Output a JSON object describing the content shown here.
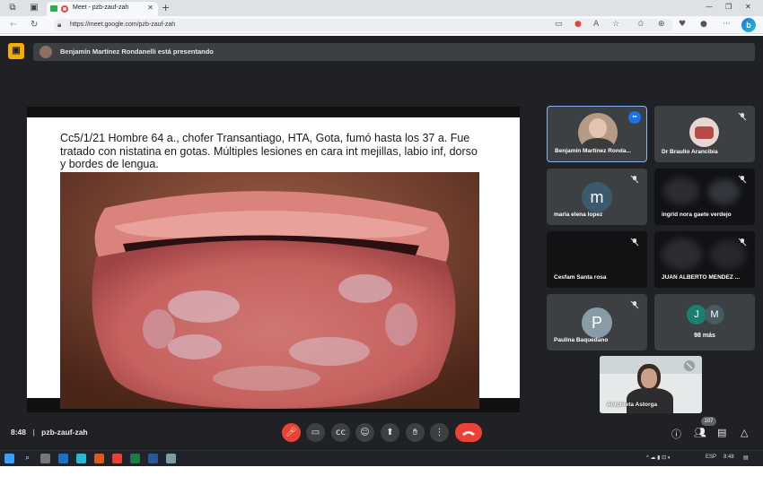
{
  "browser": {
    "tab_title": "Meet - pzb-zauf-zah",
    "url": "https://meet.google.com/pzb-zauf-zah"
  },
  "presenting": {
    "text": "Benjamín Martínez Rondanelli está presentando"
  },
  "slide": {
    "text": "Cc5/1/21 Hombre 64 a., chofer Transantiago, HTA, Gota, fumó hasta los 37 a. Fue tratado con nistatina en gotas. Múltiples lesiones en cara int mejillas, labio inf, dorso y bordes de lengua."
  },
  "participants": [
    {
      "name": "Benjamín Martínez Ronda...",
      "kind": "photo",
      "active": true
    },
    {
      "name": "Dr Braulio Arancibia",
      "kind": "photo"
    },
    {
      "name": "maria elena lopez",
      "kind": "letter",
      "letter": "m",
      "color": "#3c5a6e"
    },
    {
      "name": "ingrid nora gaete verdejo",
      "kind": "blur"
    },
    {
      "name": "Cesfam Santa rosa",
      "kind": "dark"
    },
    {
      "name": "JUAN ALBERTO MENDEZ ...",
      "kind": "blur"
    },
    {
      "name": "Paulina Baquedano",
      "kind": "letter",
      "letter": "P",
      "color": "#8a9ba8"
    },
    {
      "name": "98 más",
      "kind": "more",
      "letters": [
        "J",
        "M"
      ],
      "colors": [
        "#1a7f71",
        "#4a5a63"
      ]
    }
  ],
  "self_view": {
    "name": "Antonieta Astorga"
  },
  "bottom": {
    "time": "8:48",
    "separator": "|",
    "meeting_code": "pzb-zauf-zah",
    "people_count": "107"
  },
  "taskbar": {
    "lang": "ESP",
    "time": "8:48"
  },
  "colors": {
    "meet_bg": "#202124",
    "tile_bg": "#3c4043",
    "hangup": "#ea4335",
    "present_accent": "#f9ab00",
    "active_border": "#8ab4f8"
  }
}
